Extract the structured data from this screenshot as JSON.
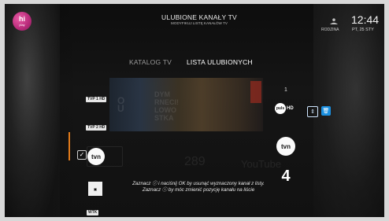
{
  "app": {
    "logo_main": "hi",
    "logo_sub": "play"
  },
  "header": {
    "title": "ULUBIONE KANAŁY TV",
    "subtitle": "MODYFIKUJ LISTĘ KANAŁÓW TV",
    "user_label": "RODZINA",
    "time": "12:44",
    "date": "PT, 25 STY"
  },
  "tabs": [
    {
      "label": "KATALOG TV",
      "active": false
    },
    {
      "label": "LISTA ULUBIONYCH",
      "active": true
    }
  ],
  "catalog_channels": [
    {
      "label": "TVP 1 HD"
    },
    {
      "label": "TVP 2 HD"
    },
    {
      "label": "tvn",
      "checked": true
    },
    {
      "label": "WTK"
    }
  ],
  "favorites": {
    "index": "1",
    "items": [
      {
        "label": "puls",
        "badge": "HD"
      },
      {
        "label": "tvn"
      },
      {
        "label": "4"
      }
    ]
  },
  "actions": {
    "move_icon": "⇕",
    "delete_icon": "🗑"
  },
  "hint": "Zaznacz ⓘ i naciśnij OK by usunąć wyznaczony kanał z listy. Zaznacz ⓘ by móc zmienić pozycję kanału na liście",
  "colors": {
    "accent": "#1a8fe0",
    "selection_bar": "#e07a1a"
  }
}
